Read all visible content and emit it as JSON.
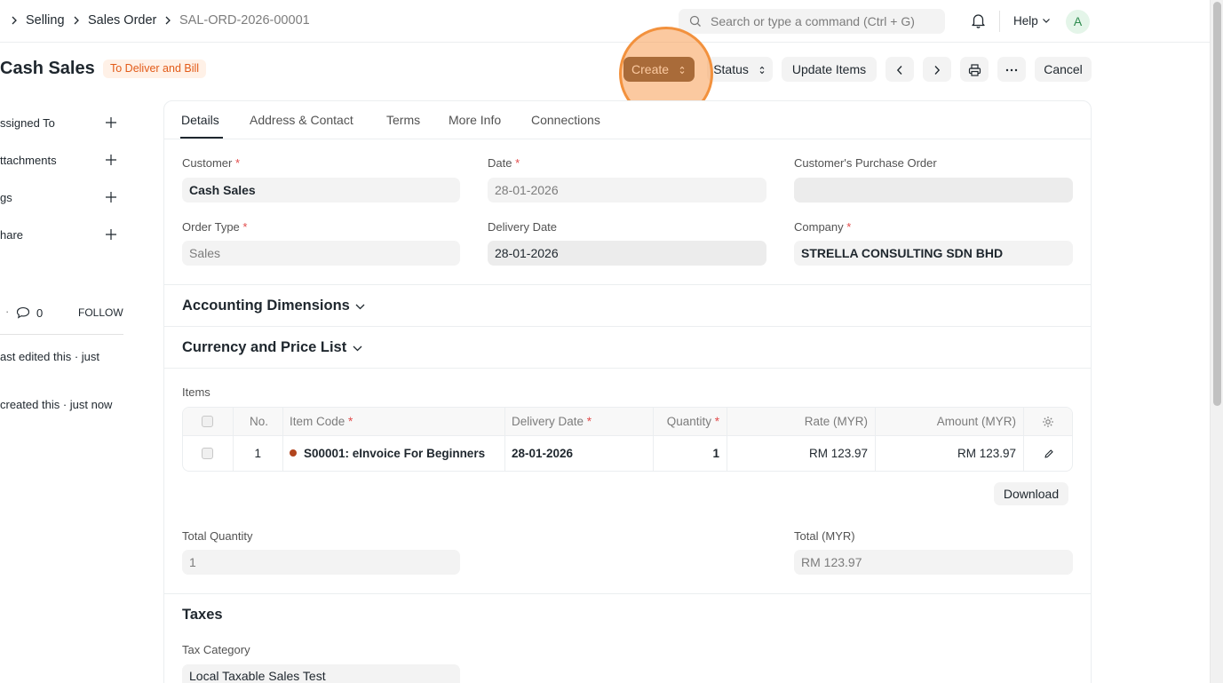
{
  "navbar": {
    "breadcrumbs": [
      "Selling",
      "Sales Order",
      "SAL-ORD-2026-00001"
    ],
    "search_placeholder": "Search or type a command (Ctrl + G)",
    "help_label": "Help",
    "avatar_initial": "A"
  },
  "header": {
    "title": "Cash Sales",
    "status_badge": "To Deliver and Bill",
    "buttons": {
      "create": "Create",
      "status": "Status",
      "update_items": "Update Items",
      "cancel": "Cancel"
    }
  },
  "sidebar": {
    "items": [
      {
        "label": "ssigned To"
      },
      {
        "label": "ttachments"
      },
      {
        "label": "gs"
      },
      {
        "label": "hare"
      }
    ],
    "comment_count": "0",
    "follow_label": "FOLLOW",
    "activity": [
      "ast edited this · just",
      "created this · just now"
    ]
  },
  "tabs": [
    "Details",
    "Address & Contact",
    "Terms",
    "More Info",
    "Connections"
  ],
  "form": {
    "customer": {
      "label": "Customer",
      "value": "Cash Sales"
    },
    "date": {
      "label": "Date",
      "value": "28-01-2026"
    },
    "customer_po": {
      "label": "Customer's Purchase Order",
      "value": ""
    },
    "order_type": {
      "label": "Order Type",
      "value": "Sales"
    },
    "delivery_date": {
      "label": "Delivery Date",
      "value": "28-01-2026"
    },
    "company": {
      "label": "Company",
      "value": "STRELLA CONSULTING SDN BHD"
    }
  },
  "sections": {
    "accounting_dimensions": "Accounting Dimensions",
    "currency_price_list": "Currency and Price List",
    "taxes": "Taxes"
  },
  "items": {
    "label": "Items",
    "columns": [
      "No.",
      "Item Code",
      "Delivery Date",
      "Quantity",
      "Rate (MYR)",
      "Amount (MYR)"
    ],
    "rows": [
      {
        "no": "1",
        "item_code": "S00001: eInvoice For Beginners",
        "delivery_date": "28-01-2026",
        "quantity": "1",
        "rate": "RM 123.97",
        "amount": "RM 123.97"
      }
    ],
    "download_label": "Download"
  },
  "totals": {
    "total_quantity": {
      "label": "Total Quantity",
      "value": "1"
    },
    "total": {
      "label": "Total (MYR)",
      "value": "RM 123.97"
    }
  },
  "taxes": {
    "tax_category": {
      "label": "Tax Category",
      "value": "Local Taxable Sales Test"
    }
  },
  "colors": {
    "primary_button": "#4a2f1b",
    "badge_text": "#e25b19",
    "badge_bg": "#fff1e7",
    "highlight": "#f2913d",
    "required": "#e24c4c"
  }
}
